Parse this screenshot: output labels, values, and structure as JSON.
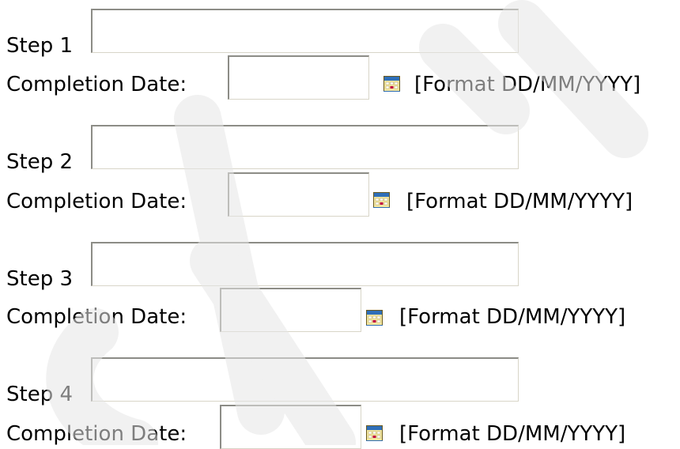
{
  "steps": [
    {
      "label": "Step 1",
      "value": "",
      "date_label": "Completion Date:",
      "date_value": "",
      "format_hint": "[Format DD/MM/YYYY]"
    },
    {
      "label": "Step 2",
      "value": "",
      "date_label": "Completion Date:",
      "date_value": "",
      "format_hint": "[Format DD/MM/YYYY]"
    },
    {
      "label": "Step 3",
      "value": "",
      "date_label": "Completion Date:",
      "date_value": "",
      "format_hint": "[Format DD/MM/YYYY]"
    },
    {
      "label": "Step 4",
      "value": "",
      "date_label": "Completion Date:",
      "date_value": "",
      "format_hint": "[Format DD/MM/YYYY]"
    }
  ],
  "icons": {
    "calendar": "calendar-icon"
  },
  "colors": {
    "field_border_dark": "#8c8c86",
    "field_border_light": "#d8d5c8",
    "calendar_header": "#2f6fb8",
    "calendar_accent": "#c00040"
  }
}
